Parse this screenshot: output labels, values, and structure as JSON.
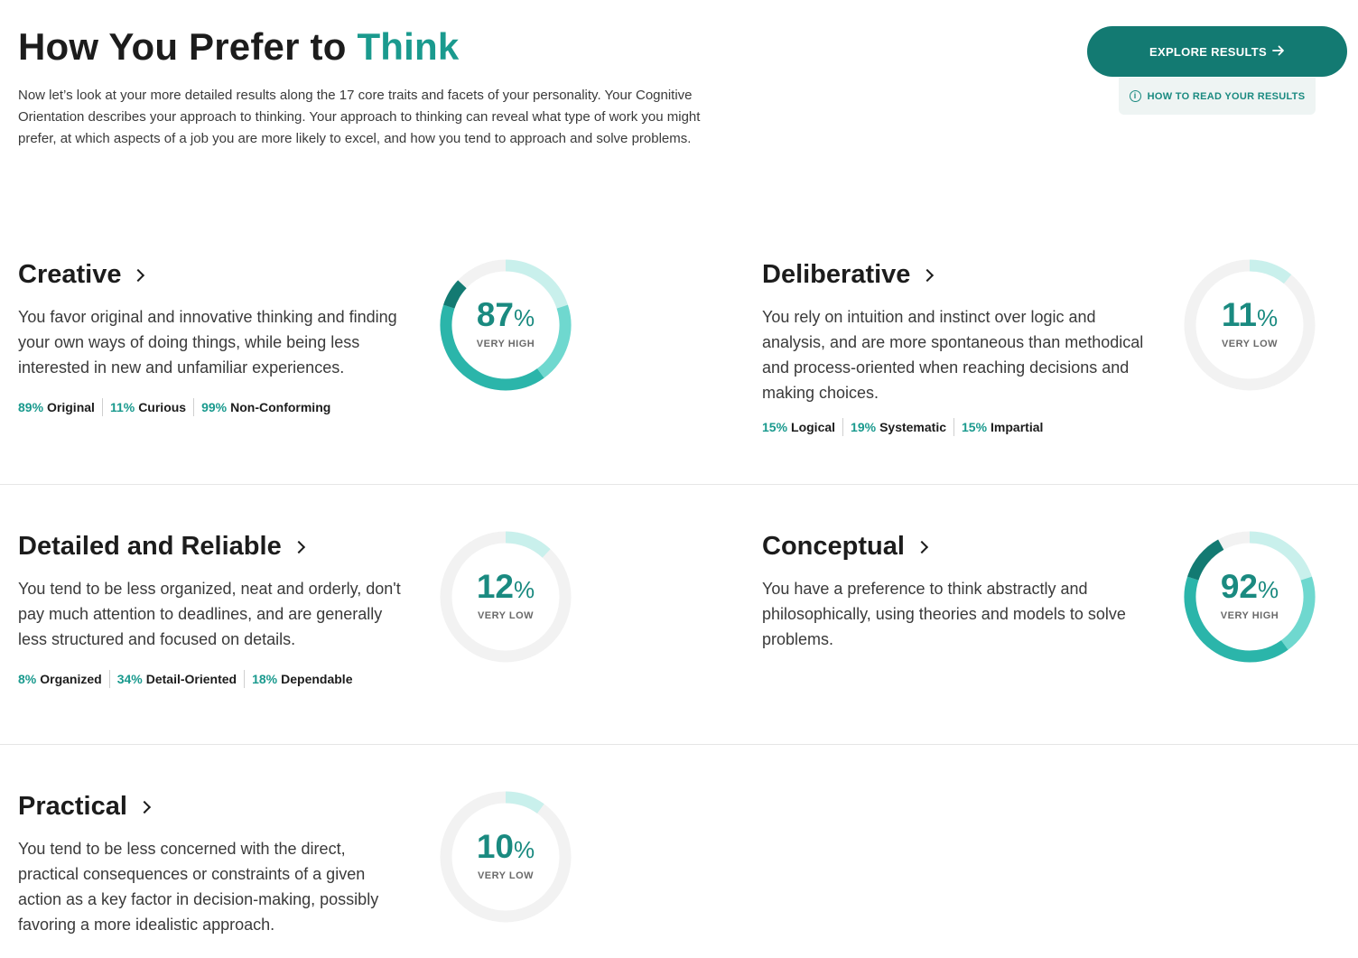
{
  "header": {
    "title_prefix": "How You Prefer to",
    "title_accent": "Think",
    "intro": "Now let’s look at your more detailed results along the 17 core traits and facets of your personality. Your Cognitive Orientation describes your approach to thinking. Your approach to thinking can reveal what type of work you might prefer, at which aspects of a job you are more likely to excel, and how you tend to approach and solve problems.",
    "explore_label": "EXPLORE RESULTS",
    "how_read_label": "HOW TO READ YOUR RESULTS"
  },
  "colors": {
    "accent": "#1a9a8e",
    "button": "#137a72",
    "ring_track": "#f2f2f2",
    "ring_light": "#c9f0ec",
    "ring_mid": "#6fd8cf",
    "ring_base": "#2bb5aa",
    "ring_deep": "#137a72"
  },
  "traits": [
    {
      "id": "creative",
      "name": "Creative",
      "description": "You favor original and innovative thinking and finding your own ways of doing things, while being less interested in new and unfamiliar experiences.",
      "score": 87,
      "level": "VERY HIGH",
      "facets": [
        {
          "pct": "89%",
          "name": "Original"
        },
        {
          "pct": "11%",
          "name": "Curious"
        },
        {
          "pct": "99%",
          "name": "Non-Conforming"
        }
      ]
    },
    {
      "id": "deliberative",
      "name": "Deliberative",
      "description": "You rely on intuition and instinct over logic and analysis, and are more spontaneous than methodical and process-oriented when reaching decisions and making choices.",
      "score": 11,
      "level": "VERY LOW",
      "facets": [
        {
          "pct": "15%",
          "name": "Logical"
        },
        {
          "pct": "19%",
          "name": "Systematic"
        },
        {
          "pct": "15%",
          "name": "Impartial"
        }
      ]
    },
    {
      "id": "detailed",
      "name": "Detailed and Reliable",
      "description": "You tend to be less organized, neat and orderly, don't pay much attention to deadlines, and are generally less structured and focused on details.",
      "score": 12,
      "level": "VERY LOW",
      "facets": [
        {
          "pct": "8%",
          "name": "Organized"
        },
        {
          "pct": "34%",
          "name": "Detail-Oriented"
        },
        {
          "pct": "18%",
          "name": "Dependable"
        }
      ]
    },
    {
      "id": "conceptual",
      "name": "Conceptual",
      "description": "You have a preference to think abstractly and philosophically, using theories and models to solve problems.",
      "score": 92,
      "level": "VERY HIGH",
      "facets": []
    },
    {
      "id": "practical",
      "name": "Practical",
      "description": "You tend to be less concerned with the direct, practical consequences or constraints of a given action as a key factor in decision-making, possibly favoring a more idealistic approach.",
      "score": 10,
      "level": "VERY LOW",
      "facets": []
    }
  ]
}
